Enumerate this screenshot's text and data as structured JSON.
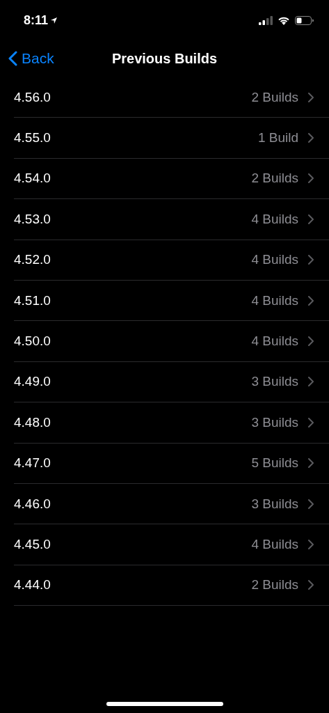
{
  "status_bar": {
    "time": "8:11"
  },
  "nav": {
    "back": "Back",
    "title": "Previous Builds"
  },
  "rows": [
    {
      "version": "4.56.0",
      "builds": "2 Builds"
    },
    {
      "version": "4.55.0",
      "builds": "1 Build"
    },
    {
      "version": "4.54.0",
      "builds": "2 Builds"
    },
    {
      "version": "4.53.0",
      "builds": "4 Builds"
    },
    {
      "version": "4.52.0",
      "builds": "4 Builds"
    },
    {
      "version": "4.51.0",
      "builds": "4 Builds"
    },
    {
      "version": "4.50.0",
      "builds": "4 Builds"
    },
    {
      "version": "4.49.0",
      "builds": "3 Builds"
    },
    {
      "version": "4.48.0",
      "builds": "3 Builds"
    },
    {
      "version": "4.47.0",
      "builds": "5 Builds"
    },
    {
      "version": "4.46.0",
      "builds": "3 Builds"
    },
    {
      "version": "4.45.0",
      "builds": "4 Builds"
    },
    {
      "version": "4.44.0",
      "builds": "2 Builds"
    }
  ]
}
